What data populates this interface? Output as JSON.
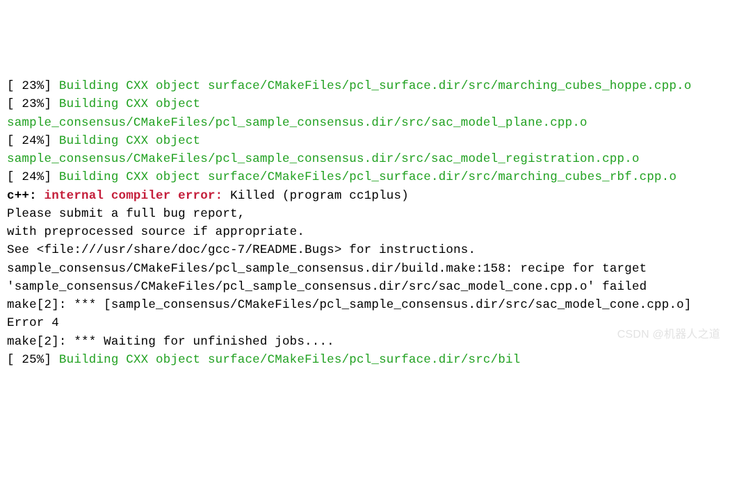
{
  "lines": {
    "l1_pct": "[ 23%] ",
    "l1_msg": "Building CXX object surface/CMakeFiles/pcl_surface.dir/src/marching_cubes_hoppe.cpp.o",
    "l2_pct": "[ 23%] ",
    "l2_msg": "Building CXX object sample_consensus/CMakeFiles/pcl_sample_consensus.dir/src/sac_model_plane.cpp.o",
    "l3_pct": "[ 24%] ",
    "l3_msg": "Building CXX object sample_consensus/CMakeFiles/pcl_sample_consensus.dir/src/sac_model_registration.cpp.o",
    "l4_pct": "[ 24%] ",
    "l4_msg": "Building CXX object surface/CMakeFiles/pcl_surface.dir/src/marching_cubes_rbf.cpp.o",
    "err_prefix": "c++: ",
    "err_label": "internal compiler error: ",
    "err_msg": "Killed (program cc1plus)",
    "report1": "Please submit a full bug report,",
    "report2": "with preprocessed source if appropriate.",
    "report3": "See <file:///usr/share/doc/gcc-7/README.Bugs> for instructions.",
    "recipe": "sample_consensus/CMakeFiles/pcl_sample_consensus.dir/build.make:158: recipe for target 'sample_consensus/CMakeFiles/pcl_sample_consensus.dir/src/sac_model_cone.cpp.o' failed",
    "make1": "make[2]: *** [sample_consensus/CMakeFiles/pcl_sample_consensus.dir/src/sac_model_cone.cpp.o] Error 4",
    "make2": "make[2]: *** Waiting for unfinished jobs....",
    "l5_pct": "[ 25%] ",
    "l5_msg": "Building CXX object surface/CMakeFiles/pcl_surface.dir/src/bil",
    "watermark": "CSDN @机器人之道"
  }
}
